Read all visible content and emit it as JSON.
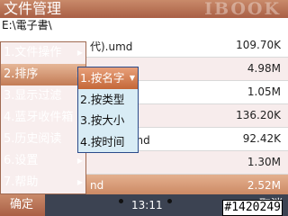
{
  "header": {
    "title": "文件管理",
    "brand": "IBOOK"
  },
  "path": "E:\\電子書\\",
  "files": [
    {
      "name": "代).umd",
      "size": "109.70K"
    },
    {
      "name": "",
      "size": "4.98M"
    },
    {
      "name": "",
      "size": "1.05M"
    },
    {
      "name": "nd",
      "size": "136.20K"
    },
    {
      "name": "信实录.umd",
      "size": "92.42K"
    },
    {
      "name": "",
      "size": "1.30M"
    },
    {
      "name": "nd",
      "size": "2.52M"
    }
  ],
  "menu": {
    "items": [
      {
        "label": "1.文件操作"
      },
      {
        "label": "2.排序"
      },
      {
        "label": "3.显示过滤"
      },
      {
        "label": "4.蓝牙收件箱"
      },
      {
        "label": "5.历史阅读"
      },
      {
        "label": "6.设置"
      },
      {
        "label": "7.帮助"
      }
    ]
  },
  "submenu": {
    "items": [
      {
        "label": "1.按名字"
      },
      {
        "label": "2.按类型"
      },
      {
        "label": "3.按大小"
      },
      {
        "label": "4.按时间"
      }
    ]
  },
  "bottom": {
    "ok": "确定",
    "time": "13:11",
    "cancel": "取消"
  },
  "overlay_id": "#1420249",
  "colors": {
    "accent": "#c37b55",
    "submenu_bg": "#d8ecf5",
    "bar": "#3c4352"
  }
}
